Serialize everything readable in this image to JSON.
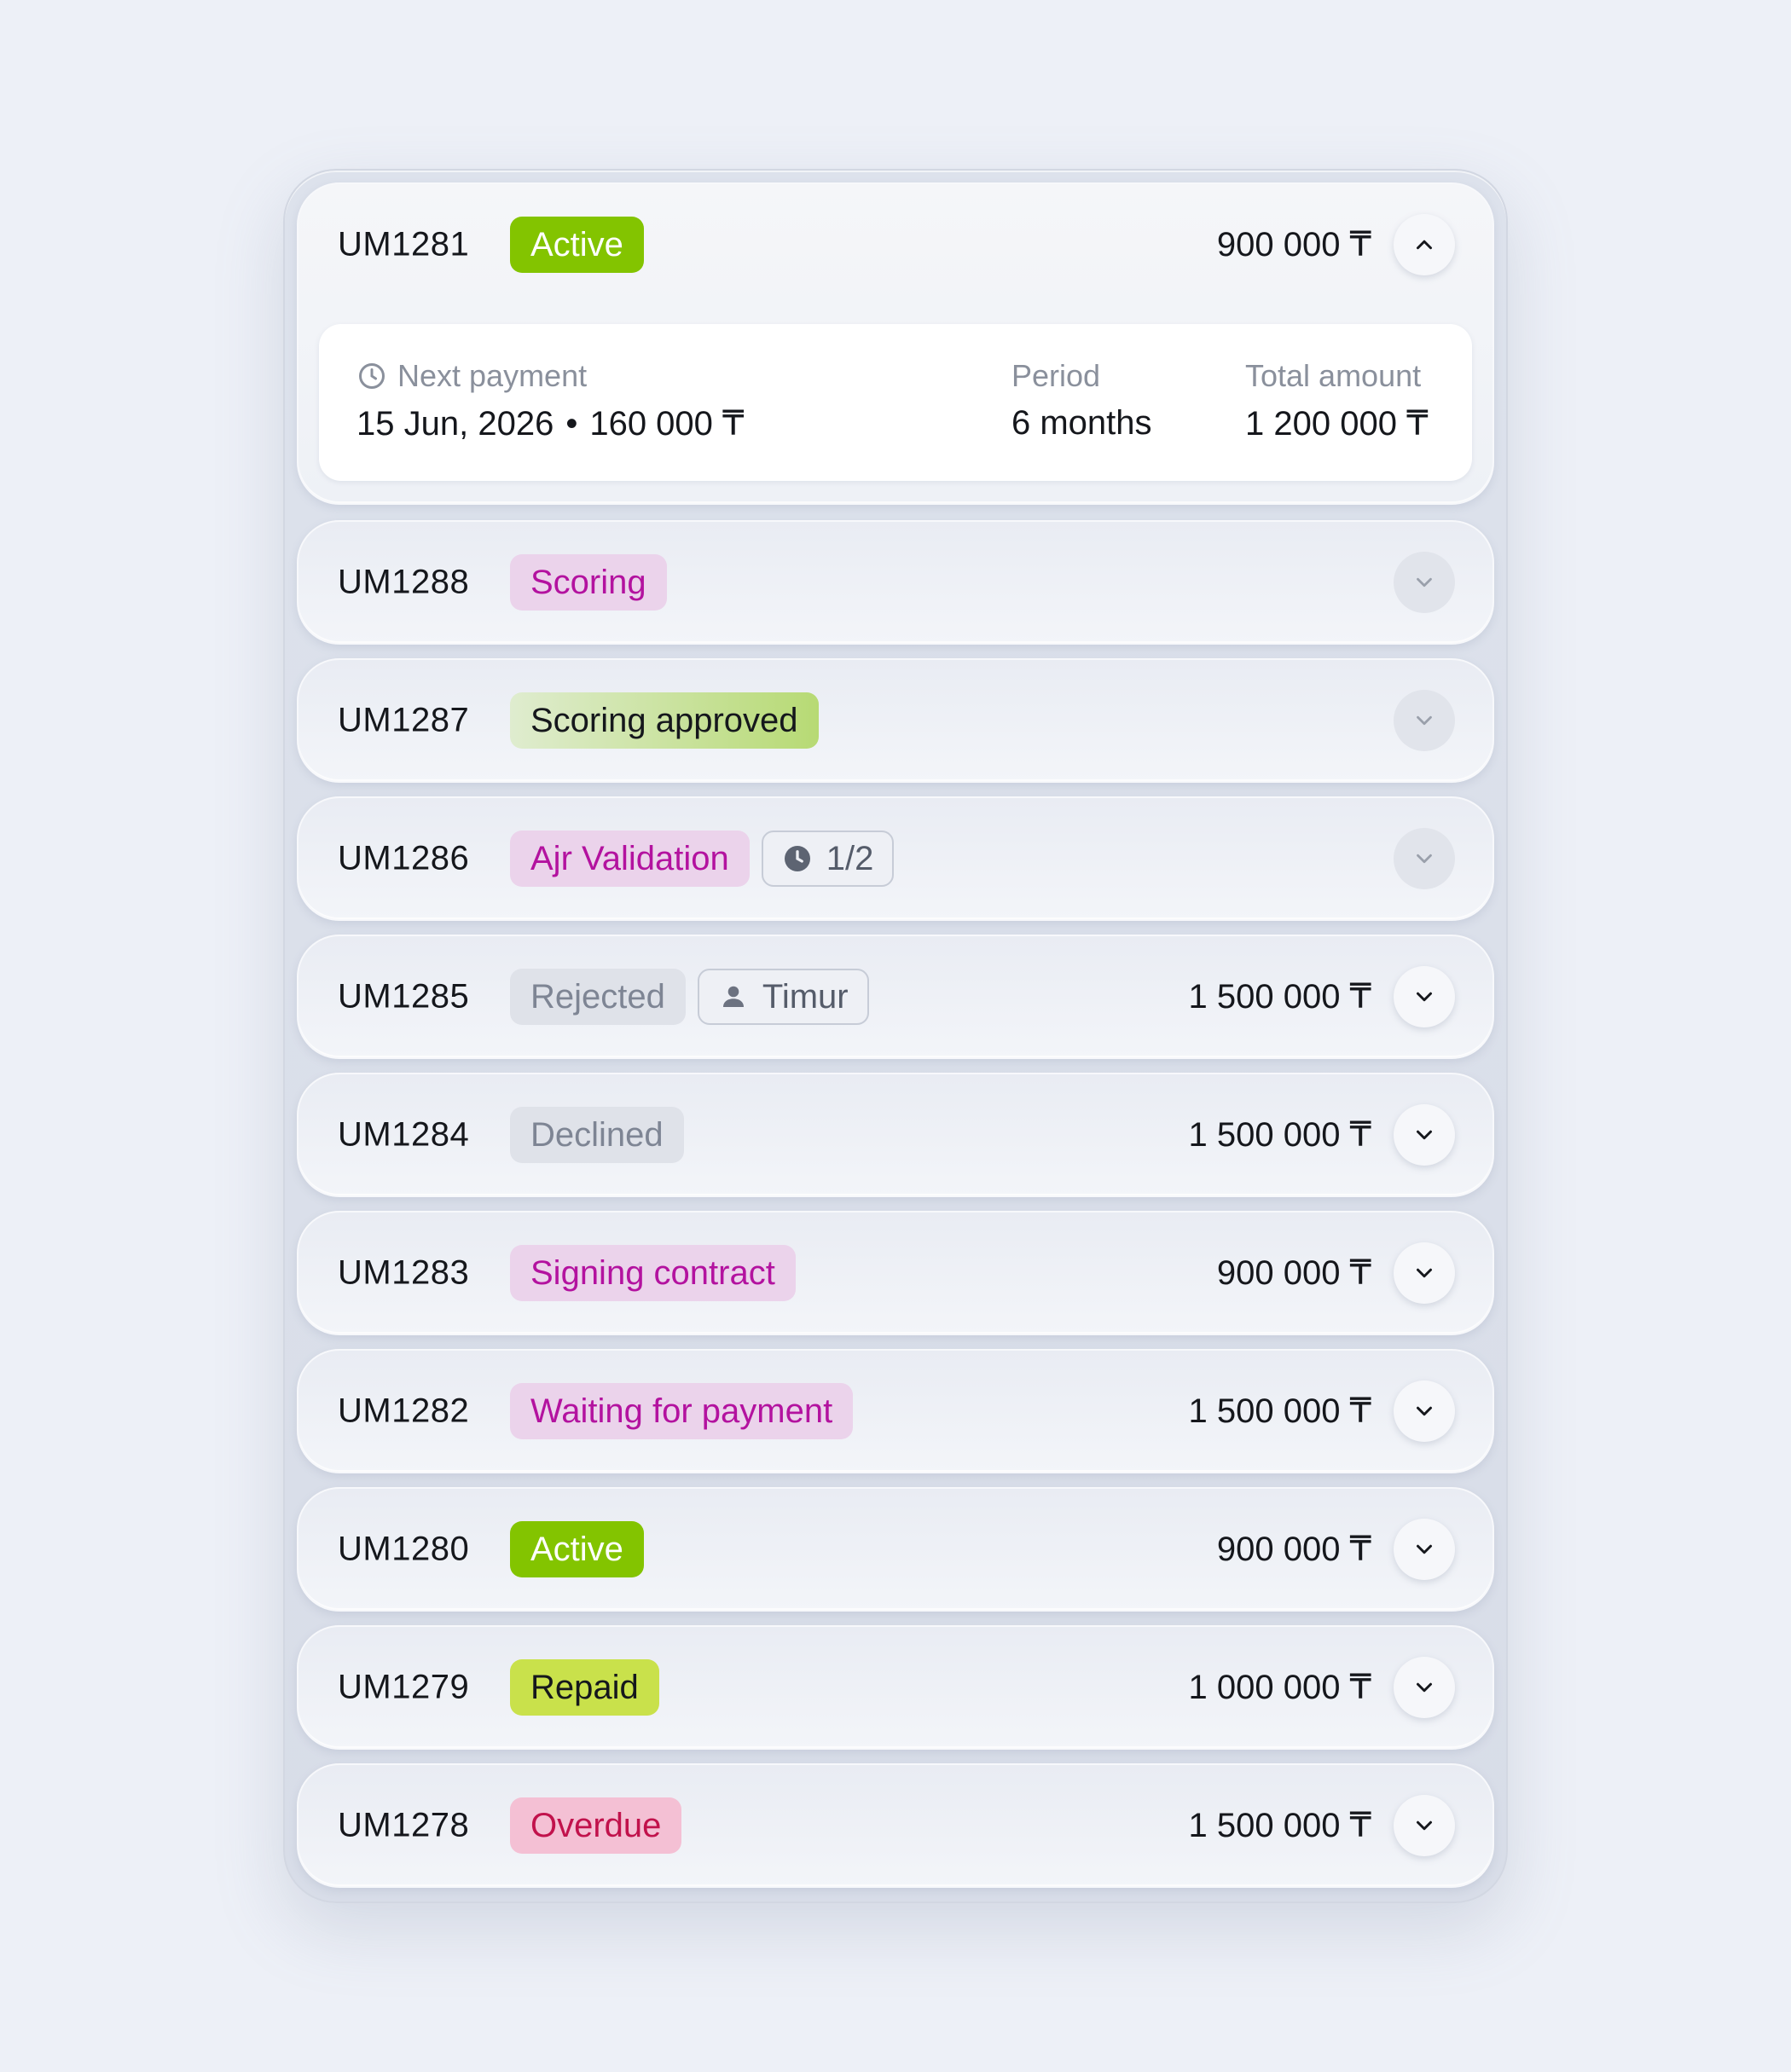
{
  "currency": "₸",
  "colors": {
    "page_background": "#edf0f7",
    "active_badge": "#83c400",
    "scoring_badge_text": "#b3129f",
    "repaid_badge": "#c9e14b",
    "overdue_badge_text": "#c1124c"
  },
  "loans": [
    {
      "id": "UM1281",
      "status": "Active",
      "status_kind": "active",
      "amount": "900 000 ₸",
      "expanded": true,
      "toggle_icon": "chevron-up-icon",
      "details": {
        "next_payment_label": "Next payment",
        "next_payment_icon": "clock-icon",
        "next_payment_date": "15 Jun, 2026",
        "next_payment_separator": "•",
        "next_payment_amount": "160 000 ₸",
        "period_label": "Period",
        "period_value": "6 months",
        "total_label": "Total amount",
        "total_value": "1 200 000 ₸"
      }
    },
    {
      "id": "UM1288",
      "status": "Scoring",
      "status_kind": "scoring",
      "amount": "",
      "toggle_icon": "chevron-down-icon",
      "toggle_muted": true
    },
    {
      "id": "UM1287",
      "status": "Scoring approved",
      "status_kind": "approved",
      "amount": "",
      "toggle_icon": "chevron-down-icon",
      "toggle_muted": true
    },
    {
      "id": "UM1286",
      "status": "Ajr Validation",
      "status_kind": "scoring",
      "chip": {
        "icon": "clock-filled-icon",
        "text": "1/2"
      },
      "amount": "",
      "toggle_icon": "chevron-down-icon",
      "toggle_muted": true
    },
    {
      "id": "UM1285",
      "status": "Rejected",
      "status_kind": "rejected",
      "chip": {
        "icon": "user-icon",
        "text": "Timur"
      },
      "amount": "1 500 000 ₸",
      "toggle_icon": "chevron-down-icon"
    },
    {
      "id": "UM1284",
      "status": "Declined",
      "status_kind": "rejected",
      "amount": "1 500 000 ₸",
      "toggle_icon": "chevron-down-icon"
    },
    {
      "id": "UM1283",
      "status": "Signing contract",
      "status_kind": "scoring",
      "amount": "900 000 ₸",
      "toggle_icon": "chevron-down-icon"
    },
    {
      "id": "UM1282",
      "status": "Waiting for payment",
      "status_kind": "scoring",
      "amount": "1 500 000 ₸",
      "toggle_icon": "chevron-down-icon"
    },
    {
      "id": "UM1280",
      "status": "Active",
      "status_kind": "active",
      "amount": "900 000 ₸",
      "toggle_icon": "chevron-down-icon"
    },
    {
      "id": "UM1279",
      "status": "Repaid",
      "status_kind": "repaid",
      "amount": "1 000 000 ₸",
      "toggle_icon": "chevron-down-icon"
    },
    {
      "id": "UM1278",
      "status": "Overdue",
      "status_kind": "overdue",
      "amount": "1 500 000 ₸",
      "toggle_icon": "chevron-down-icon"
    }
  ]
}
